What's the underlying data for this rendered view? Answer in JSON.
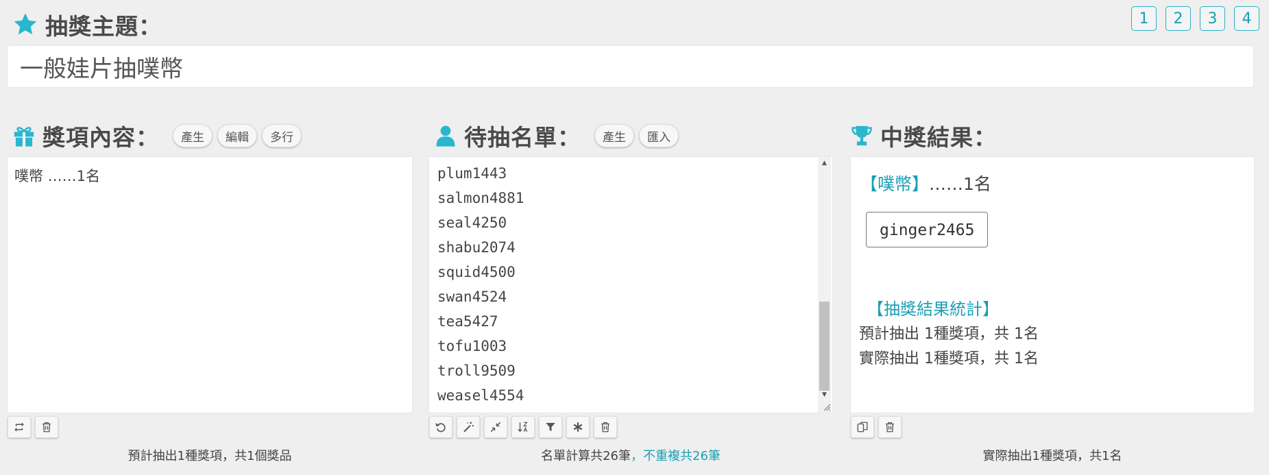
{
  "header": {
    "title": "抽獎主題："
  },
  "page_tabs": [
    "1",
    "2",
    "3",
    "4"
  ],
  "theme": {
    "value": "一般娃片抽噗幣"
  },
  "prize_section": {
    "title": "獎項內容：",
    "buttons": [
      "產生",
      "編輯",
      "多行"
    ],
    "content": "噗幣 ……1名",
    "footer": "預計抽出1種獎項，共1個獎品"
  },
  "list_section": {
    "title": "待抽名單：",
    "buttons": [
      "產生",
      "匯入"
    ],
    "names": [
      "plum1443",
      "salmon4881",
      "seal4250",
      "shabu2074",
      "squid4500",
      "swan4524",
      "tea5427",
      "tofu1003",
      "troll9509",
      "weasel4554"
    ],
    "footer_total": "名單計算共26筆",
    "footer_unique": "，不重複共26筆"
  },
  "result_section": {
    "title": "中獎結果：",
    "category": "【噗幣】",
    "category_count": "……1名",
    "winner": "ginger2465",
    "stats_title": "【抽獎結果統計】",
    "stats_expected": "預計抽出 1種獎項，共 1名",
    "stats_actual": "實際抽出 1種獎項，共 1名",
    "footer": "實際抽出1種獎項，共1名"
  },
  "colors": {
    "accent": "#29b6cf",
    "text": "#444444",
    "background": "#efefef"
  },
  "icons": {
    "header": "star-icon",
    "prize": "gift-icon",
    "list": "user-icon",
    "result": "trophy-icon"
  }
}
